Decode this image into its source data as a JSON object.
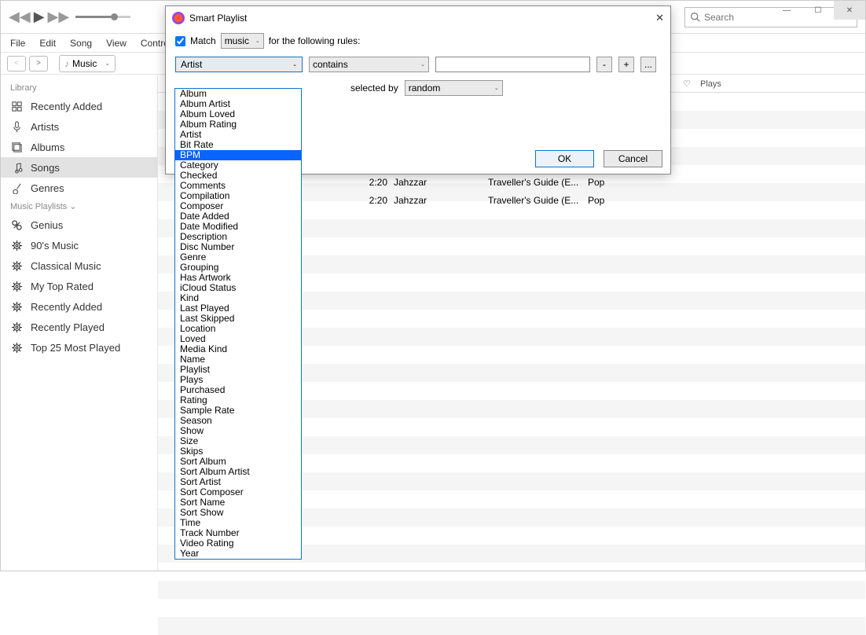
{
  "window": {
    "search_placeholder": "Search"
  },
  "menubar": [
    "File",
    "Edit",
    "Song",
    "View",
    "Controls"
  ],
  "library_dropdown": "Music",
  "sidebar": {
    "library_header": "Library",
    "library": [
      {
        "label": "Recently Added"
      },
      {
        "label": "Artists"
      },
      {
        "label": "Albums"
      },
      {
        "label": "Songs",
        "selected": true
      },
      {
        "label": "Genres"
      }
    ],
    "playlists_header": "Music Playlists",
    "playlists": [
      {
        "label": "Genius",
        "icon": "genius"
      },
      {
        "label": "90's Music",
        "icon": "gear"
      },
      {
        "label": "Classical Music",
        "icon": "gear"
      },
      {
        "label": "My Top Rated",
        "icon": "gear"
      },
      {
        "label": "Recently Added",
        "icon": "gear"
      },
      {
        "label": "Recently Played",
        "icon": "gear"
      },
      {
        "label": "Top 25 Most Played",
        "icon": "gear"
      }
    ]
  },
  "columns": {
    "plays": "Plays"
  },
  "tracks": [
    {
      "time": "2:20",
      "artist": "Jahzzar",
      "album": "Traveller's Guide (E...",
      "genre": "Pop"
    },
    {
      "time": "2:20",
      "artist": "Jahzzar",
      "album": "Traveller's Guide (E...",
      "genre": "Pop"
    }
  ],
  "dialog": {
    "title": "Smart Playlist",
    "match_label": "Match",
    "match_select": "music",
    "match_suffix": "for the following rules:",
    "field_select": "Artist",
    "contains_select": "contains",
    "textinput": "",
    "minus": "-",
    "plus": "+",
    "ellipsis": "...",
    "selected_by_label": "selected by",
    "selected_by_select": "random",
    "ok": "OK",
    "cancel": "Cancel"
  },
  "dropdown_options": [
    "Album",
    "Album Artist",
    "Album Loved",
    "Album Rating",
    "Artist",
    "Bit Rate",
    "BPM",
    "Category",
    "Checked",
    "Comments",
    "Compilation",
    "Composer",
    "Date Added",
    "Date Modified",
    "Description",
    "Disc Number",
    "Genre",
    "Grouping",
    "Has Artwork",
    "iCloud Status",
    "Kind",
    "Last Played",
    "Last Skipped",
    "Location",
    "Loved",
    "Media Kind",
    "Name",
    "Playlist",
    "Plays",
    "Purchased",
    "Rating",
    "Sample Rate",
    "Season",
    "Show",
    "Size",
    "Skips",
    "Sort Album",
    "Sort Album Artist",
    "Sort Artist",
    "Sort Composer",
    "Sort Name",
    "Sort Show",
    "Time",
    "Track Number",
    "Video Rating",
    "Year"
  ],
  "dropdown_highlight": "BPM"
}
